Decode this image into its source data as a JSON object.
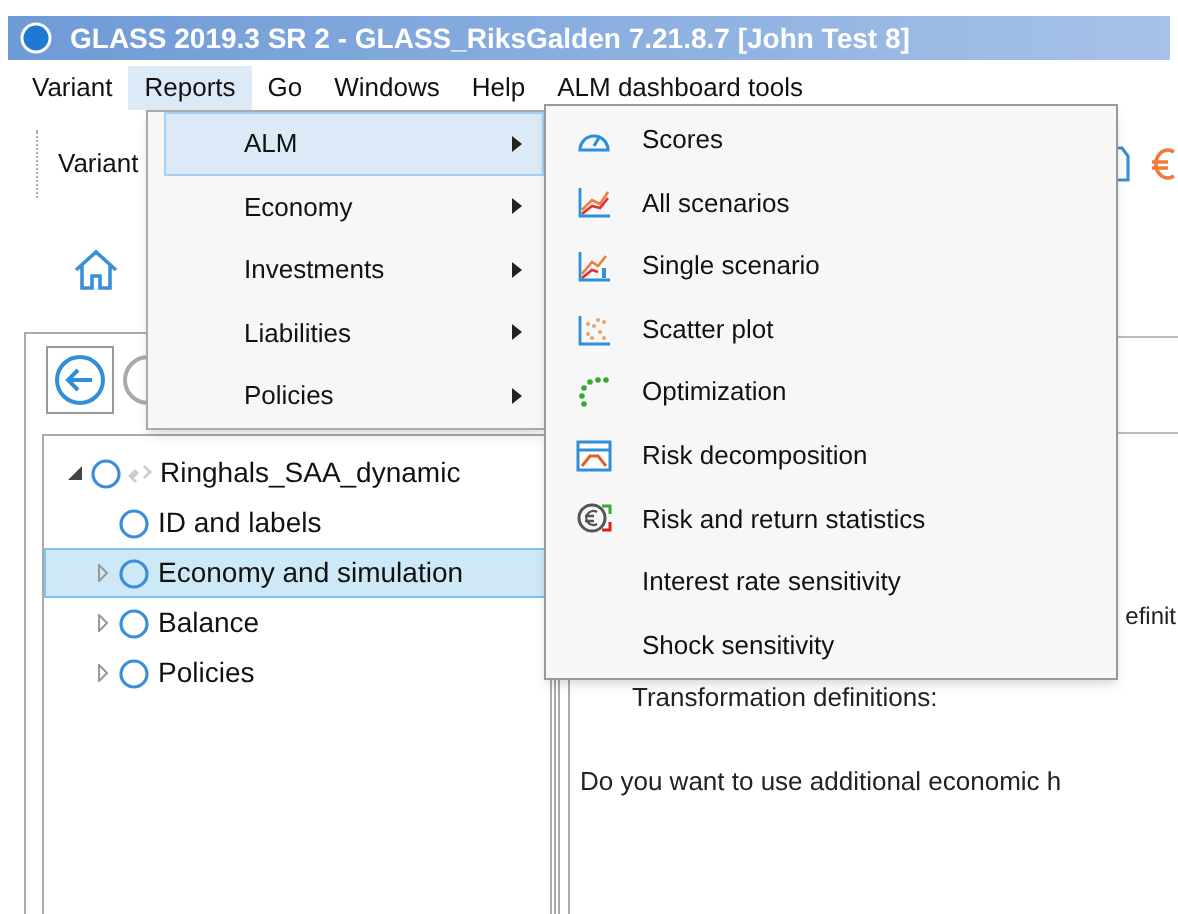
{
  "window": {
    "title": "GLASS 2019.3 SR 2 - GLASS_RiksGalden 7.21.8.7 [John Test 8]"
  },
  "menu_bar": [
    {
      "label": "Variant",
      "selected": false
    },
    {
      "label": "Reports",
      "selected": true
    },
    {
      "label": "Go",
      "selected": false
    },
    {
      "label": "Windows",
      "selected": false
    },
    {
      "label": "Help",
      "selected": false
    },
    {
      "label": "ALM dashboard tools",
      "selected": false
    }
  ],
  "toolbar": {
    "label": "Variant"
  },
  "tree": [
    {
      "label": "Ringhals_SAA_dynamic",
      "expanded": true,
      "selected": false,
      "children": [
        {
          "label": "ID and labels",
          "selected": false
        },
        {
          "label": "Economy and simulation",
          "expanded": false,
          "selected": true
        },
        {
          "label": "Balance",
          "expanded": false,
          "selected": false
        },
        {
          "label": "Policies",
          "expanded": false,
          "selected": false
        }
      ]
    }
  ],
  "content": {
    "partial_label": "efinit",
    "heading": "Transformation definitions:",
    "question": "Do you want to use additional economic h"
  },
  "reports_menu": [
    {
      "label": "ALM",
      "selected": true
    },
    {
      "label": "Economy",
      "selected": false
    },
    {
      "label": "Investments",
      "selected": false
    },
    {
      "label": "Liabilities",
      "selected": false
    },
    {
      "label": "Policies",
      "selected": false
    }
  ],
  "alm_submenu": [
    {
      "label": "Scores",
      "kind": "gauge"
    },
    {
      "label": "All scenarios",
      "kind": "lines"
    },
    {
      "label": "Single scenario",
      "kind": "single"
    },
    {
      "label": "Scatter plot",
      "kind": "scatter"
    },
    {
      "label": "Optimization",
      "kind": "frontier"
    },
    {
      "label": "Risk decomposition",
      "kind": "window"
    },
    {
      "label": "Risk and return statistics",
      "kind": "euro"
    },
    {
      "label": "Interest rate sensitivity",
      "kind": "none"
    },
    {
      "label": "Shock sensitivity",
      "kind": "none"
    }
  ]
}
